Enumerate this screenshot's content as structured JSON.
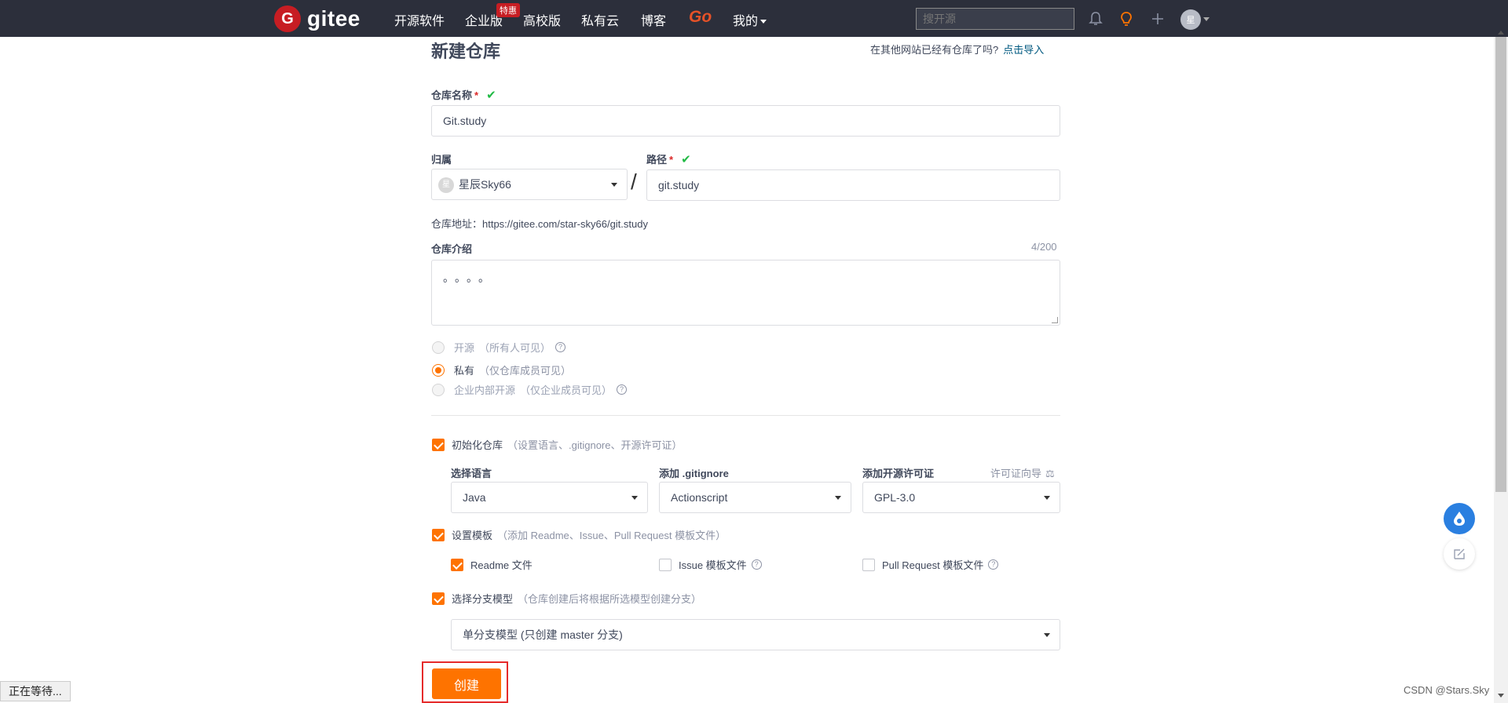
{
  "nav": {
    "logo_letter": "G",
    "logo_text": "gitee",
    "items": [
      "开源软件",
      "企业版",
      "高校版",
      "私有云",
      "博客"
    ],
    "badge": "特惠",
    "go": "Go",
    "mine": "我的",
    "search_placeholder": "搜开源",
    "avatar_initial": "星"
  },
  "form": {
    "title": "新建仓库",
    "import_hint": "在其他网站已经有仓库了吗?",
    "import_link": "点击导入",
    "name_label": "仓库名称",
    "required_mark": "*",
    "name_value": "Git.study",
    "owner_label": "归属",
    "owner_initial": "星",
    "owner_value": "星辰Sky66",
    "path_label": "路径",
    "path_value": "git.study",
    "slash": "/",
    "repo_url": "仓库地址：https://gitee.com/star-sky66/git.study",
    "desc_label": "仓库介绍",
    "desc_counter": "4/200",
    "desc_value": "。。。。",
    "visibility": [
      {
        "label": "开源",
        "hint": "（所有人可见）",
        "selected": false,
        "disabled": true,
        "help": true
      },
      {
        "label": "私有",
        "hint": "（仅仓库成员可见）",
        "selected": true,
        "disabled": false,
        "help": false
      },
      {
        "label": "企业内部开源",
        "hint": "（仅企业成员可见）",
        "selected": false,
        "disabled": true,
        "help": true
      }
    ],
    "init_label": "初始化仓库",
    "init_hint": "（设置语言、.gitignore、开源许可证）",
    "lang_label": "选择语言",
    "lang_value": "Java",
    "gitignore_label": "添加 .gitignore",
    "gitignore_value": "Actionscript",
    "license_label": "添加开源许可证",
    "license_guide": "许可证向导",
    "license_value": "GPL-3.0",
    "template_label": "设置模板",
    "template_hint": "（添加 Readme、Issue、Pull Request 模板文件）",
    "readme_label": "Readme 文件",
    "issue_label": "Issue 模板文件",
    "pr_label": "Pull Request 模板文件",
    "branch_label": "选择分支模型",
    "branch_hint": "（仓库创建后将根据所选模型创建分支）",
    "branch_value": "单分支模型 (只创建 master 分支)",
    "create_label": "创建"
  },
  "status_text": "正在等待...",
  "watermark": "CSDN @Stars.Sky",
  "colors": {
    "accent": "#fe7300",
    "nav_bg": "#2c2f3b",
    "brand": "#c71d23",
    "link": "#005980",
    "highlight_box": "#e52b2b"
  }
}
